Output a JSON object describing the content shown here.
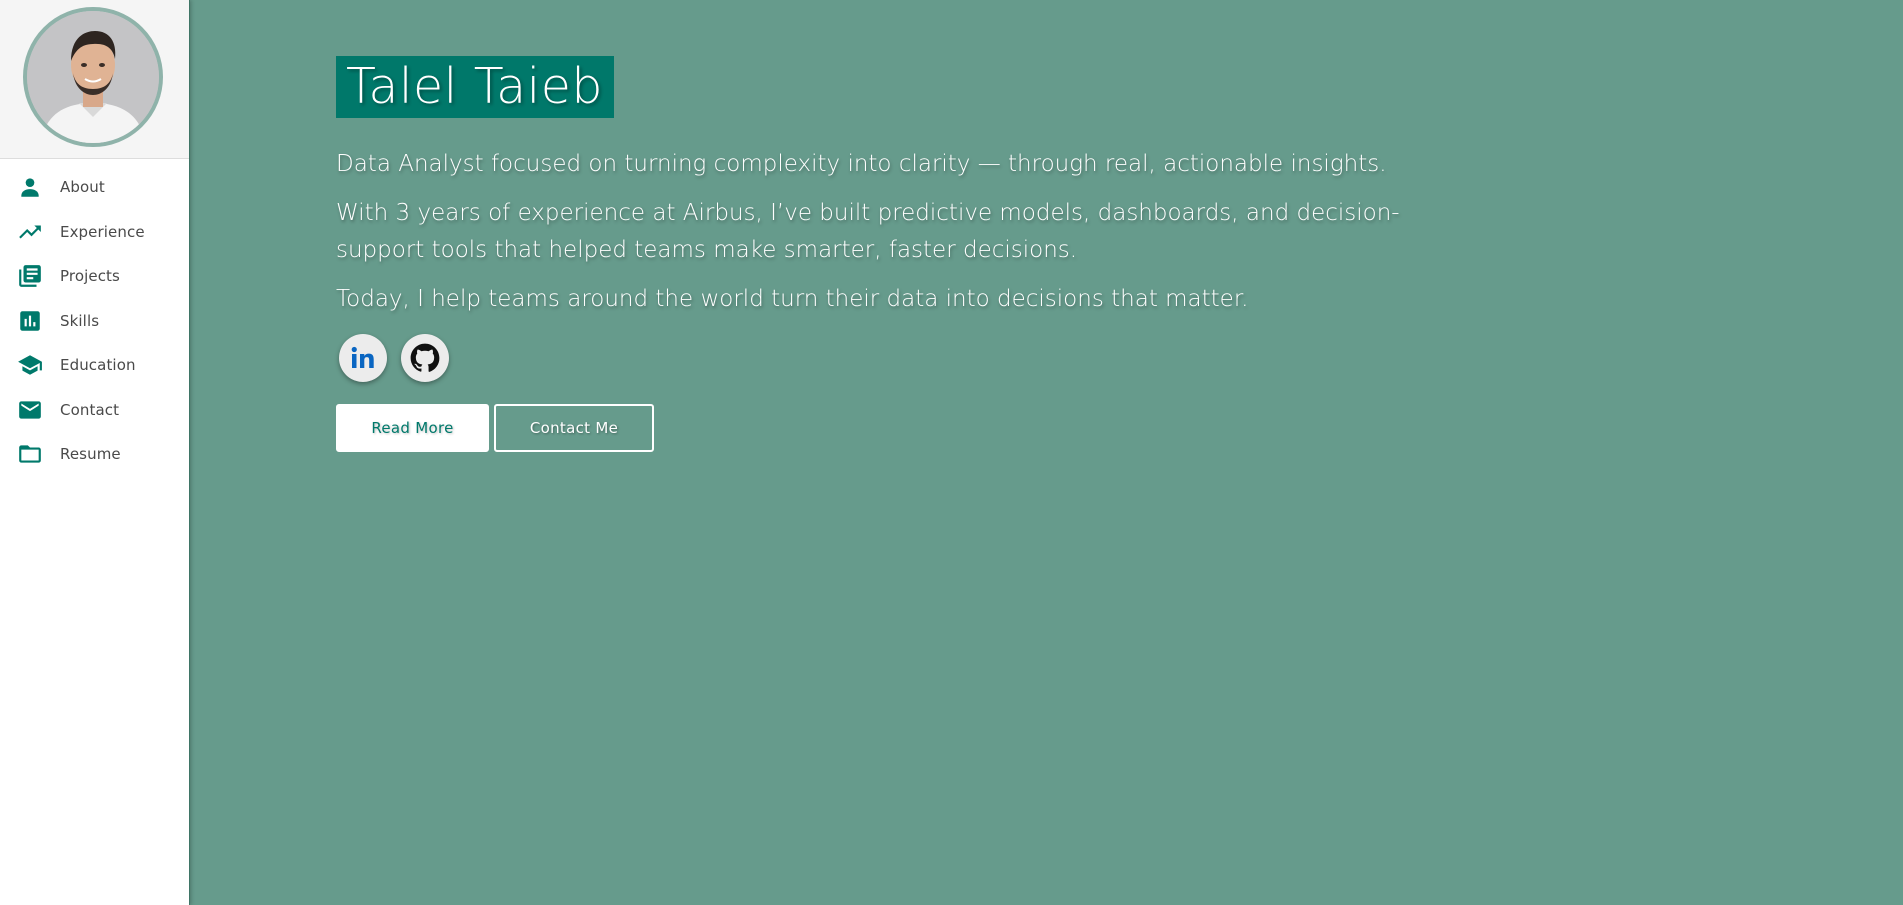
{
  "sidebar": {
    "items": [
      {
        "label": "About",
        "icon": "person-icon"
      },
      {
        "label": "Experience",
        "icon": "trending-up-icon"
      },
      {
        "label": "Projects",
        "icon": "library-books-icon"
      },
      {
        "label": "Skills",
        "icon": "bar-chart-icon"
      },
      {
        "label": "Education",
        "icon": "school-icon"
      },
      {
        "label": "Contact",
        "icon": "mail-icon"
      },
      {
        "label": "Resume",
        "icon": "folder-icon"
      }
    ]
  },
  "hero": {
    "name": "Talel Taieb",
    "tagline": "Data Analyst focused on turning complexity into clarity — through real, actionable insights.",
    "experience": "With 3 years of experience at Airbus, I’ve built predictive models, dashboards, and decision-support tools that helped teams make smarter, faster decisions.",
    "today": "Today, I help teams around the world turn their data into decisions that matter."
  },
  "socials": [
    {
      "icon": "linkedin-icon"
    },
    {
      "icon": "github-icon"
    }
  ],
  "buttons": {
    "read_more": "Read More",
    "contact_me": "Contact Me"
  },
  "colors": {
    "background": "#669b8c",
    "accent": "#00786a",
    "sidebar": "#ffffff"
  }
}
